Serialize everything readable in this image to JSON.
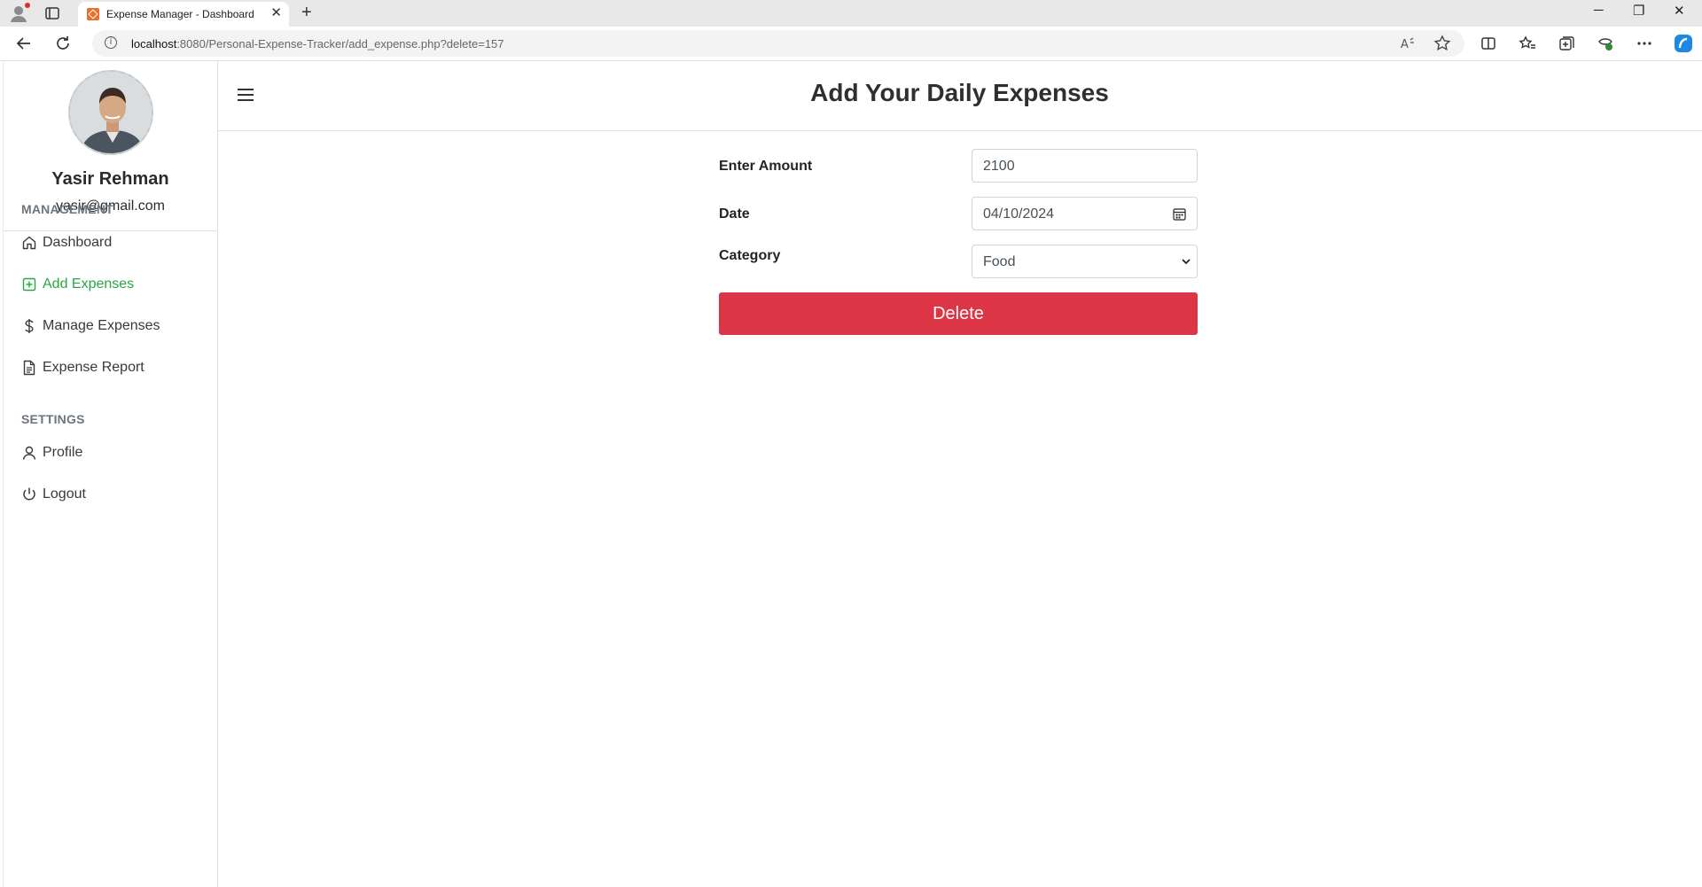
{
  "browser": {
    "tab_title": "Expense Manager - Dashboard",
    "tab_close": "✕",
    "new_tab": "+",
    "url_host": "localhost",
    "url_rest": ":8080/Personal-Expense-Tracker/add_expense.php?delete=157",
    "window_controls": {
      "minimize": "─",
      "restore": "❐",
      "close": "✕"
    }
  },
  "sidebar": {
    "user_name": "Yasir Rehman",
    "user_email": "yasir@gmail.com",
    "sections": {
      "management": "MANAGEMENT",
      "settings": "SETTINGS"
    },
    "items": [
      {
        "label": "Dashboard",
        "icon": "home-icon"
      },
      {
        "label": "Add Expenses",
        "icon": "plus-square-icon",
        "active": true
      },
      {
        "label": "Manage Expenses",
        "icon": "dollar-icon"
      },
      {
        "label": "Expense Report",
        "icon": "document-icon"
      },
      {
        "label": "Profile",
        "icon": "user-icon"
      },
      {
        "label": "Logout",
        "icon": "power-icon"
      }
    ],
    "active_color": "#28a745"
  },
  "header": {
    "title": "Add Your Daily Expenses"
  },
  "form": {
    "amount_label": "Enter Amount",
    "amount_value": "2100",
    "date_label": "Date",
    "date_value": "04/10/2024",
    "category_label": "Category",
    "category_value": "Food",
    "delete_label": "Delete",
    "delete_color": "#dc3545"
  }
}
